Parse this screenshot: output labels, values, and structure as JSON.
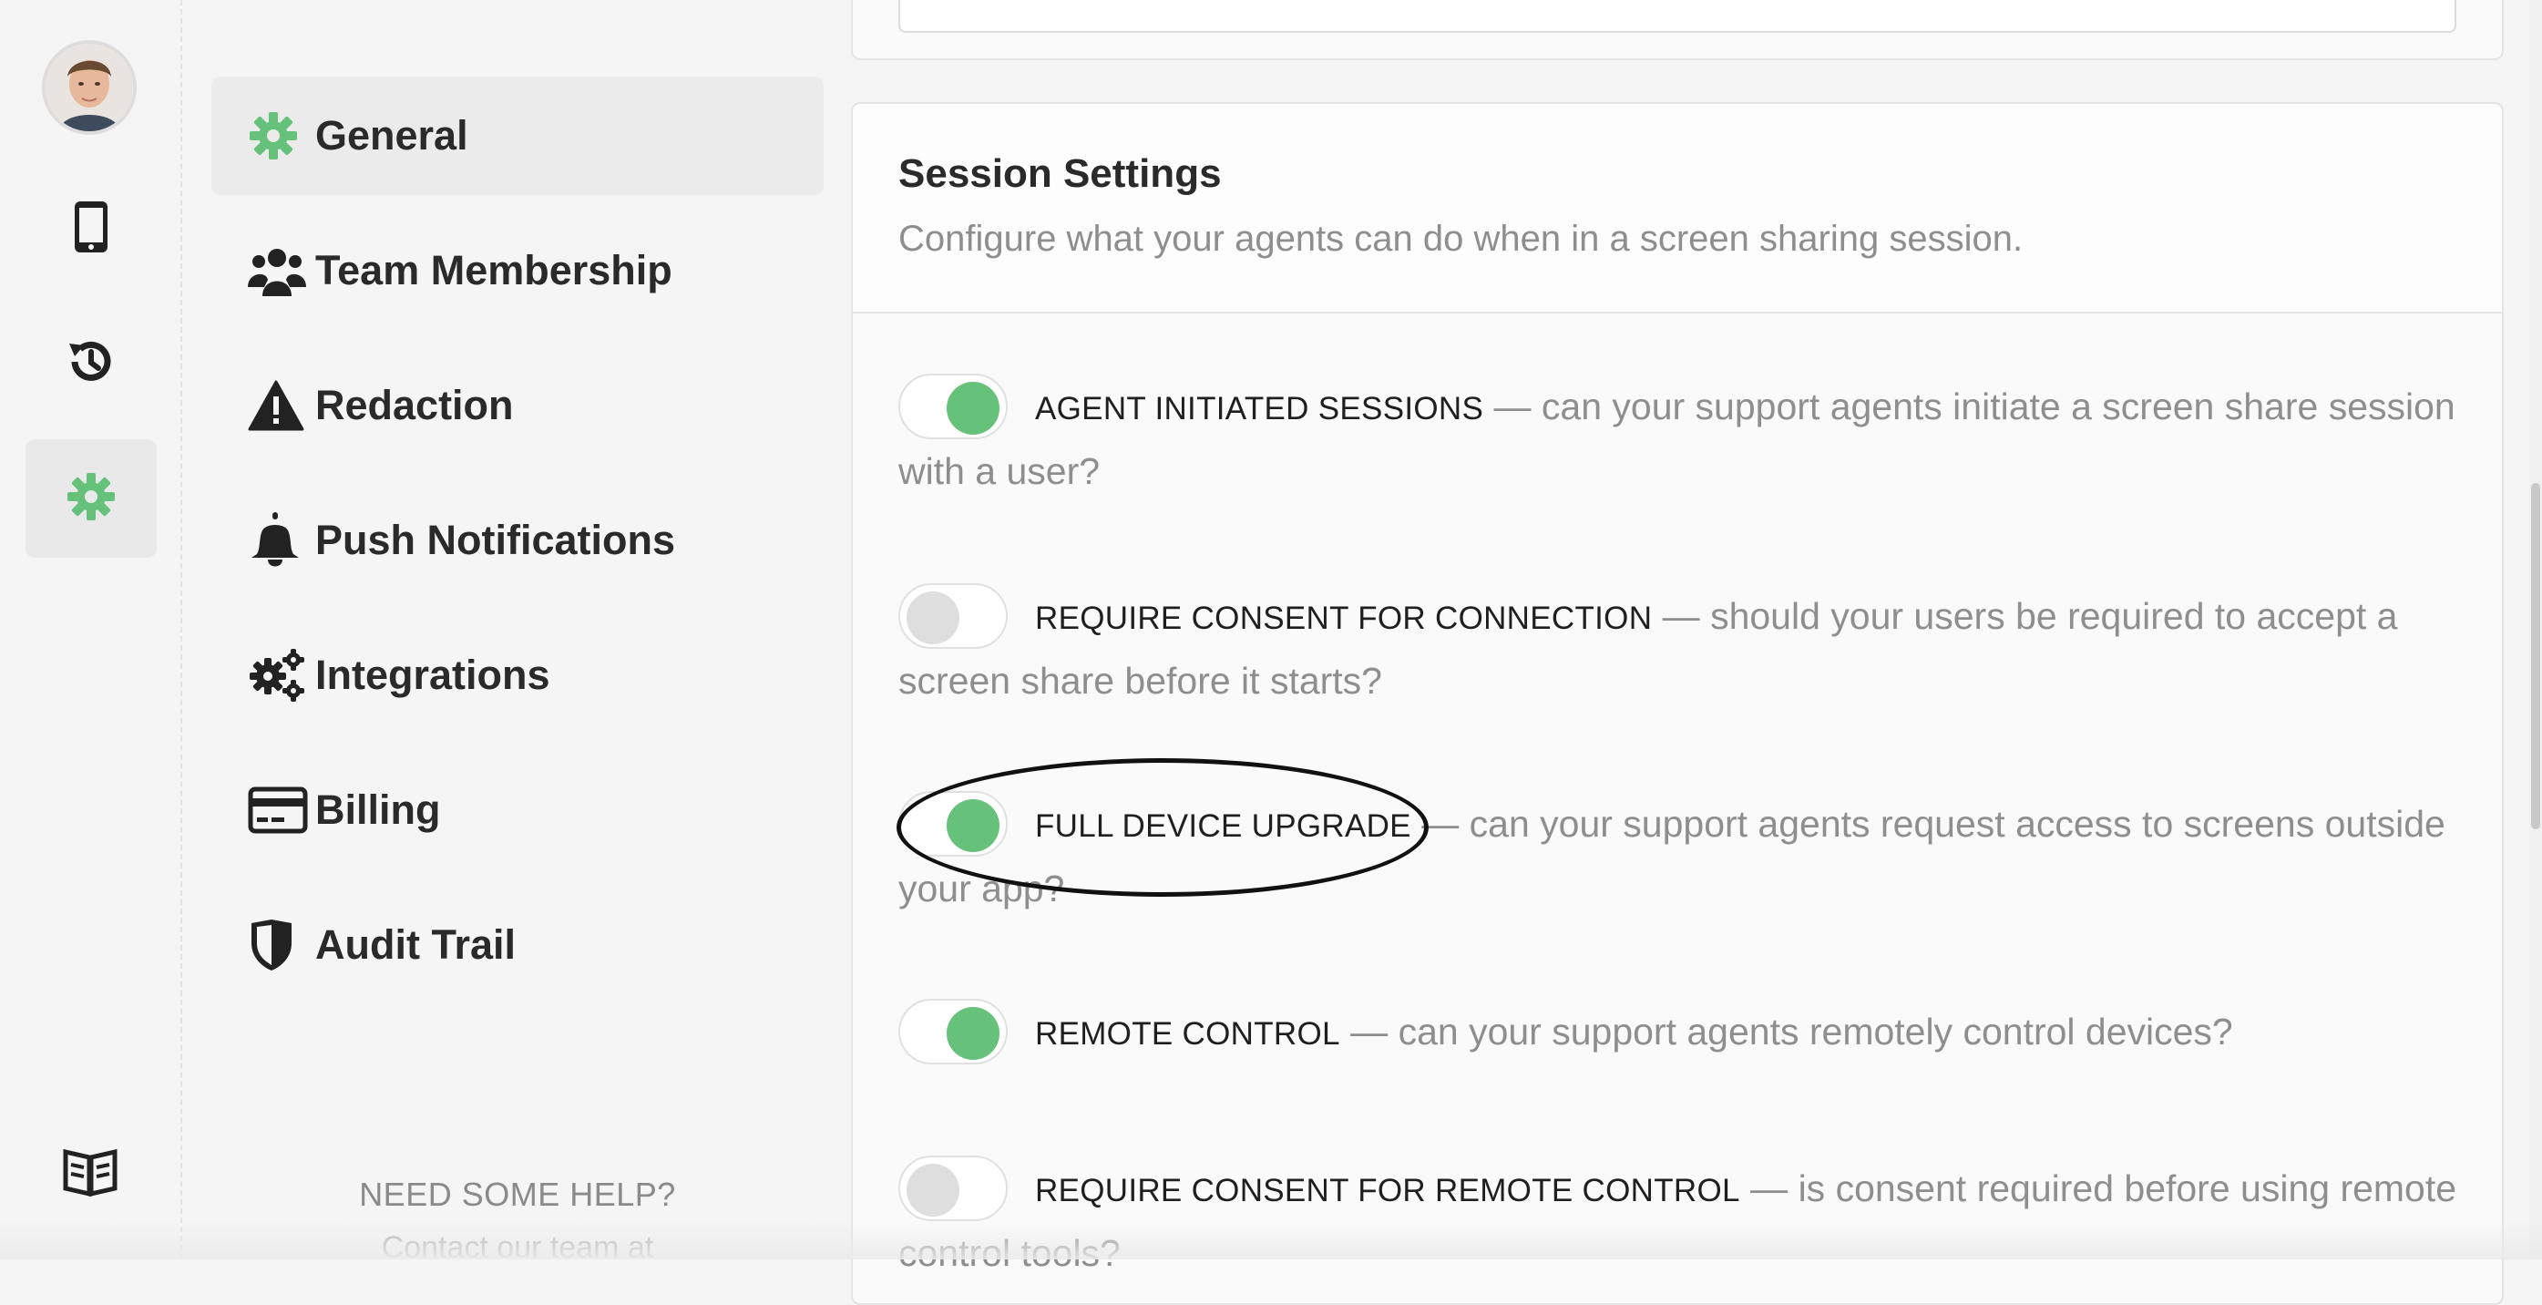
{
  "colors": {
    "accent_green": "#66c17b",
    "toggle_off": "#dedede",
    "muted_text": "#8e8e8e"
  },
  "rail": {
    "avatar_icon": "user-avatar",
    "items": [
      {
        "icon": "mobile-phone-icon",
        "active": false
      },
      {
        "icon": "history-icon",
        "active": false
      },
      {
        "icon": "gear-icon",
        "active": true
      }
    ],
    "bottom_icon": "book-open-icon"
  },
  "nav": {
    "items": [
      {
        "label": "General",
        "icon": "gear-icon",
        "active": true
      },
      {
        "label": "Team Membership",
        "icon": "users-icon",
        "active": false
      },
      {
        "label": "Redaction",
        "icon": "warning-icon",
        "active": false
      },
      {
        "label": "Push Notifications",
        "icon": "bell-icon",
        "active": false
      },
      {
        "label": "Integrations",
        "icon": "gears-icon",
        "active": false
      },
      {
        "label": "Billing",
        "icon": "credit-card-icon",
        "active": false
      },
      {
        "label": "Audit Trail",
        "icon": "shield-icon",
        "active": false
      }
    ],
    "help_title": "NEED SOME HELP?",
    "help_sub": "Contact our team at"
  },
  "session": {
    "title": "Session Settings",
    "description": "Configure what your agents can do when in a screen sharing session.",
    "settings": [
      {
        "name": "AGENT INITIATED SESSIONS",
        "desc": "can your support agents initiate a screen share session with a user?",
        "enabled": true
      },
      {
        "name": "REQUIRE CONSENT FOR CONNECTION",
        "desc": "should your users be required to accept a screen share before it starts?",
        "enabled": false
      },
      {
        "name": "FULL DEVICE UPGRADE",
        "desc": "can your support agents request access to screens outside your app?",
        "enabled": true
      },
      {
        "name": "REMOTE CONTROL",
        "desc": "can your support agents remotely control devices?",
        "enabled": true
      },
      {
        "name": "REQUIRE CONSENT FOR REMOTE CONTROL",
        "desc": "is consent required before using remote control tools?",
        "enabled": false
      }
    ],
    "separator": " — "
  }
}
